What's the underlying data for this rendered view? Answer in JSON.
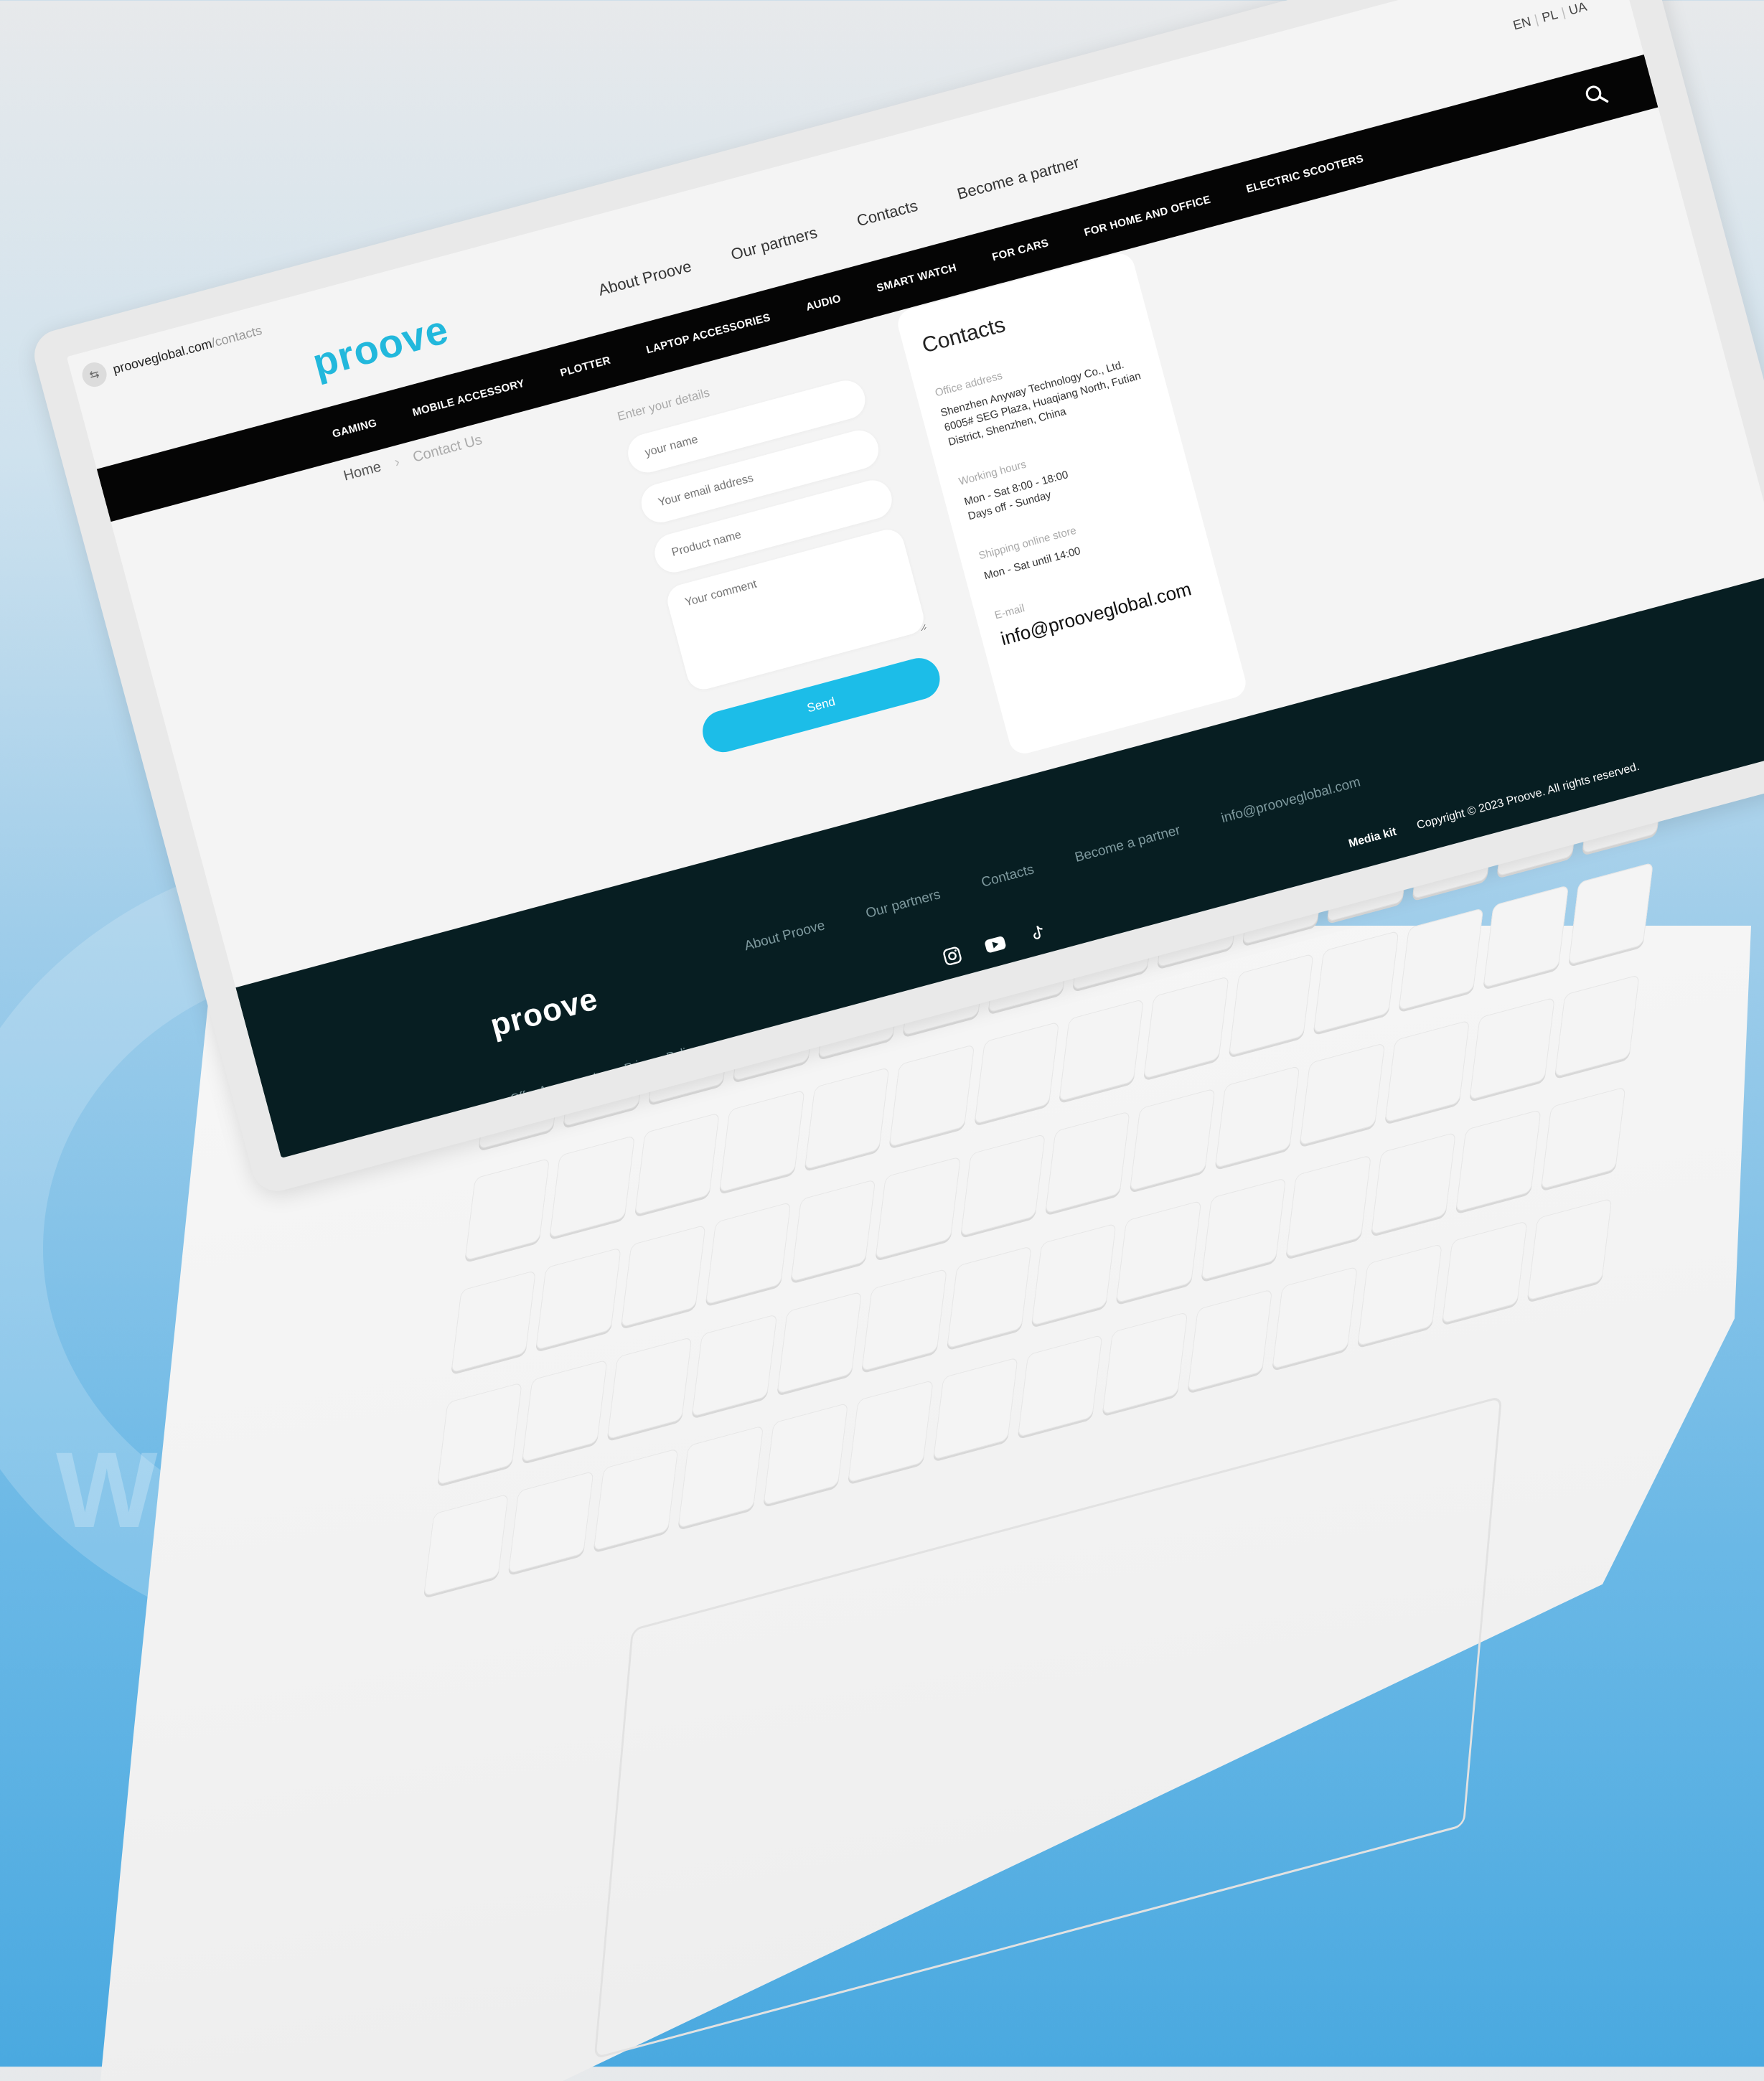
{
  "browser": {
    "url_domain": "prooveglobal.com",
    "url_path": "/contacts"
  },
  "header": {
    "logo": "proove",
    "links": [
      "About Proove",
      "Our partners",
      "Contacts",
      "Become a partner"
    ],
    "languages": [
      "EN",
      "PL",
      "UA"
    ],
    "categories": [
      "GAMING",
      "MOBILE ACCESSORY",
      "PLOTTER",
      "LAPTOP ACCESSORIES",
      "AUDIO",
      "SMART WATCH",
      "FOR CARS",
      "FOR HOME AND OFFICE",
      "ELECTRIC SCOOTERS"
    ]
  },
  "breadcrumb": {
    "home": "Home",
    "current": "Contact Us"
  },
  "form": {
    "title": "Enter your details",
    "name_placeholder": "your name",
    "email_placeholder": "Your email address",
    "product_placeholder": "Product name",
    "comment_placeholder": "Your comment",
    "send_label": "Send"
  },
  "contacts": {
    "title": "Contacts",
    "office_label": "Office address",
    "office_value": "Shenzhen Anyway Technology Co., Ltd. 6005# SEG Plaza, Huaqiang North, Futian District, Shenzhen, China",
    "hours_label": "Working hours",
    "hours_value_1": "Mon - Sat 8:00 - 18:00",
    "hours_value_2": "Days off - Sunday",
    "shipping_label": "Shipping online store",
    "shipping_value": "Mon - Sat until 14:00",
    "email_label": "E-mail",
    "email_value": "info@prooveglobal.com"
  },
  "footer": {
    "logo": "proove",
    "links": [
      "About Proove",
      "Our partners",
      "Contacts",
      "Become a partner",
      "info@prooveglobal.com"
    ],
    "legal": [
      "Offer Agreement",
      "Privacy Policy"
    ],
    "social_icons": [
      "instagram-icon",
      "youtube-icon",
      "tiktok-icon"
    ],
    "media_kit": "Media kit",
    "copyright": "Copyright © 2023 Proove. All rights reserved."
  },
  "colors": {
    "accent": "#1cbde8",
    "nav_bg": "#050505",
    "footer_bg": "#071e22"
  }
}
